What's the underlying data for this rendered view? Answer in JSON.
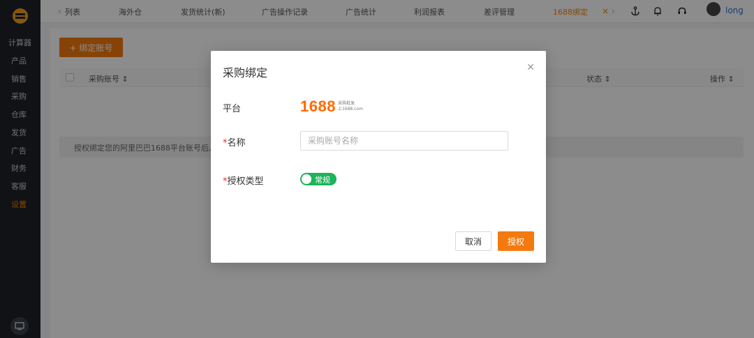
{
  "sidebar": {
    "items": [
      {
        "label": "计算器"
      },
      {
        "label": "产品"
      },
      {
        "label": "销售"
      },
      {
        "label": "采购"
      },
      {
        "label": "仓库"
      },
      {
        "label": "发货"
      },
      {
        "label": "广告"
      },
      {
        "label": "财务"
      },
      {
        "label": "客服"
      },
      {
        "label": "设置"
      }
    ],
    "active_color": "#f08400"
  },
  "topnav": {
    "tabs": [
      {
        "label": "列表"
      },
      {
        "label": "海外仓"
      },
      {
        "label": "发货统计(新)"
      },
      {
        "label": "广告操作记录"
      },
      {
        "label": "广告统计"
      },
      {
        "label": "利润报表"
      },
      {
        "label": "差评管理"
      },
      {
        "label": "1688绑定"
      }
    ],
    "icons": [
      "anchor-icon",
      "bell-icon",
      "headset-icon"
    ],
    "username": "long"
  },
  "page": {
    "bind_button": "+ 绑定账号",
    "columns": [
      "采购账号 ⇕",
      "状态 ⇕",
      "操作 ⇕"
    ],
    "notice": "授权绑定您的阿里巴巴1688平台账号后,"
  },
  "modal": {
    "title": "采购绑定",
    "platform_label": "平台",
    "platform_logo": {
      "number": "1688",
      "tagline_1": "采购批发",
      "tagline_2": "上1688.com"
    },
    "name_label": "名称",
    "name_placeholder": "采购账号名称",
    "auth_type_label": "授权类型",
    "auth_type_value": "常规",
    "cancel_label": "取消",
    "confirm_label": "授权"
  },
  "colors": {
    "accent": "#f47a0e",
    "toggle_on": "#1db45a",
    "sidebar_bg": "#1f2227"
  }
}
